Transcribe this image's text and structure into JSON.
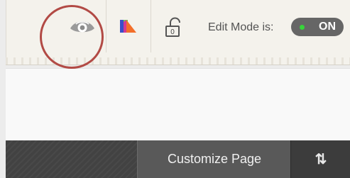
{
  "toolbar": {
    "edit_mode_label": "Edit Mode is:",
    "edit_mode_state": "ON",
    "lock_icon_digit": "0",
    "icons": {
      "preview": "eye-icon",
      "theme": "color-palette-icon",
      "lock": "unlock-icon"
    }
  },
  "nav": {
    "customize_page_label": "Customize Page",
    "sort_icon_label": "⇅"
  },
  "colors": {
    "toggle_on": "#666666",
    "toggle_dot": "#37d43a",
    "annotation_circle": "#b24a45"
  }
}
